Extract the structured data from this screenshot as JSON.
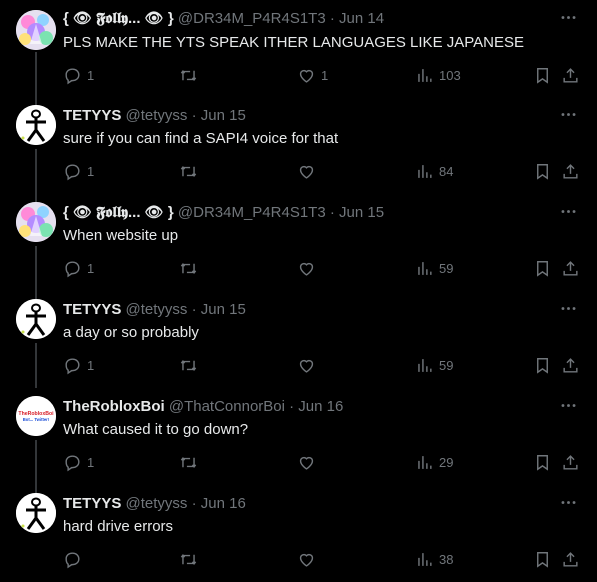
{
  "tweets": [
    {
      "id": "t1",
      "name": "{ 👁 𝕱𝖔𝖑𝖑𝖞... 👁 }",
      "handle": "@DR34M_P4R4S1T3",
      "date": "· Jun 14",
      "text": "PLS MAKE THE YTS SPEAK ITHER LANGUAGES LIKE JAPANESE",
      "replies": "1",
      "retweets": "",
      "likes": "1",
      "views": "103",
      "avatar": "pastel-art"
    },
    {
      "id": "t2",
      "name": "TETYYS",
      "handle": "@tetyyss",
      "date": "· Jun 15",
      "text": "sure if you can find a SAPI4 voice for that",
      "replies": "1",
      "retweets": "",
      "likes": "",
      "views": "84",
      "avatar": "stick-figure"
    },
    {
      "id": "t3",
      "name": "{ 👁 𝕱𝖔𝖑𝖑𝖞... 👁 }",
      "handle": "@DR34M_P4R4S1T3",
      "date": "· Jun 15",
      "text": "When website up",
      "replies": "1",
      "retweets": "",
      "likes": "",
      "views": "59",
      "avatar": "pastel-art"
    },
    {
      "id": "t4",
      "name": "TETYYS",
      "handle": "@tetyyss",
      "date": "· Jun 15",
      "text": "a day or so probably",
      "replies": "1",
      "retweets": "",
      "likes": "",
      "views": "59",
      "avatar": "stick-figure"
    },
    {
      "id": "t5",
      "name": "TheRobloxBoi",
      "handle": "@ThatConnorBoi",
      "date": "· Jun 16",
      "text": "What caused it to go down?",
      "replies": "1",
      "retweets": "",
      "likes": "",
      "views": "29",
      "avatar": "roblox-logo",
      "avatar_text": [
        "TheRobloxBoi",
        "Bot... Twitter!"
      ]
    },
    {
      "id": "t6",
      "name": "TETYYS",
      "handle": "@tetyyss",
      "date": "· Jun 16",
      "text": "hard drive errors",
      "replies": "",
      "retweets": "",
      "likes": "",
      "views": "38",
      "avatar": "stick-figure"
    }
  ],
  "icons": {
    "reply": "reply-icon",
    "retweet": "retweet-icon",
    "like": "heart-icon",
    "views": "views-icon",
    "bookmark": "bookmark-icon",
    "share": "share-icon",
    "more": "more-icon"
  },
  "colors": {
    "background": "#000000",
    "text": "#e7e9ea",
    "muted": "#71767b",
    "thread_line": "#333639"
  }
}
